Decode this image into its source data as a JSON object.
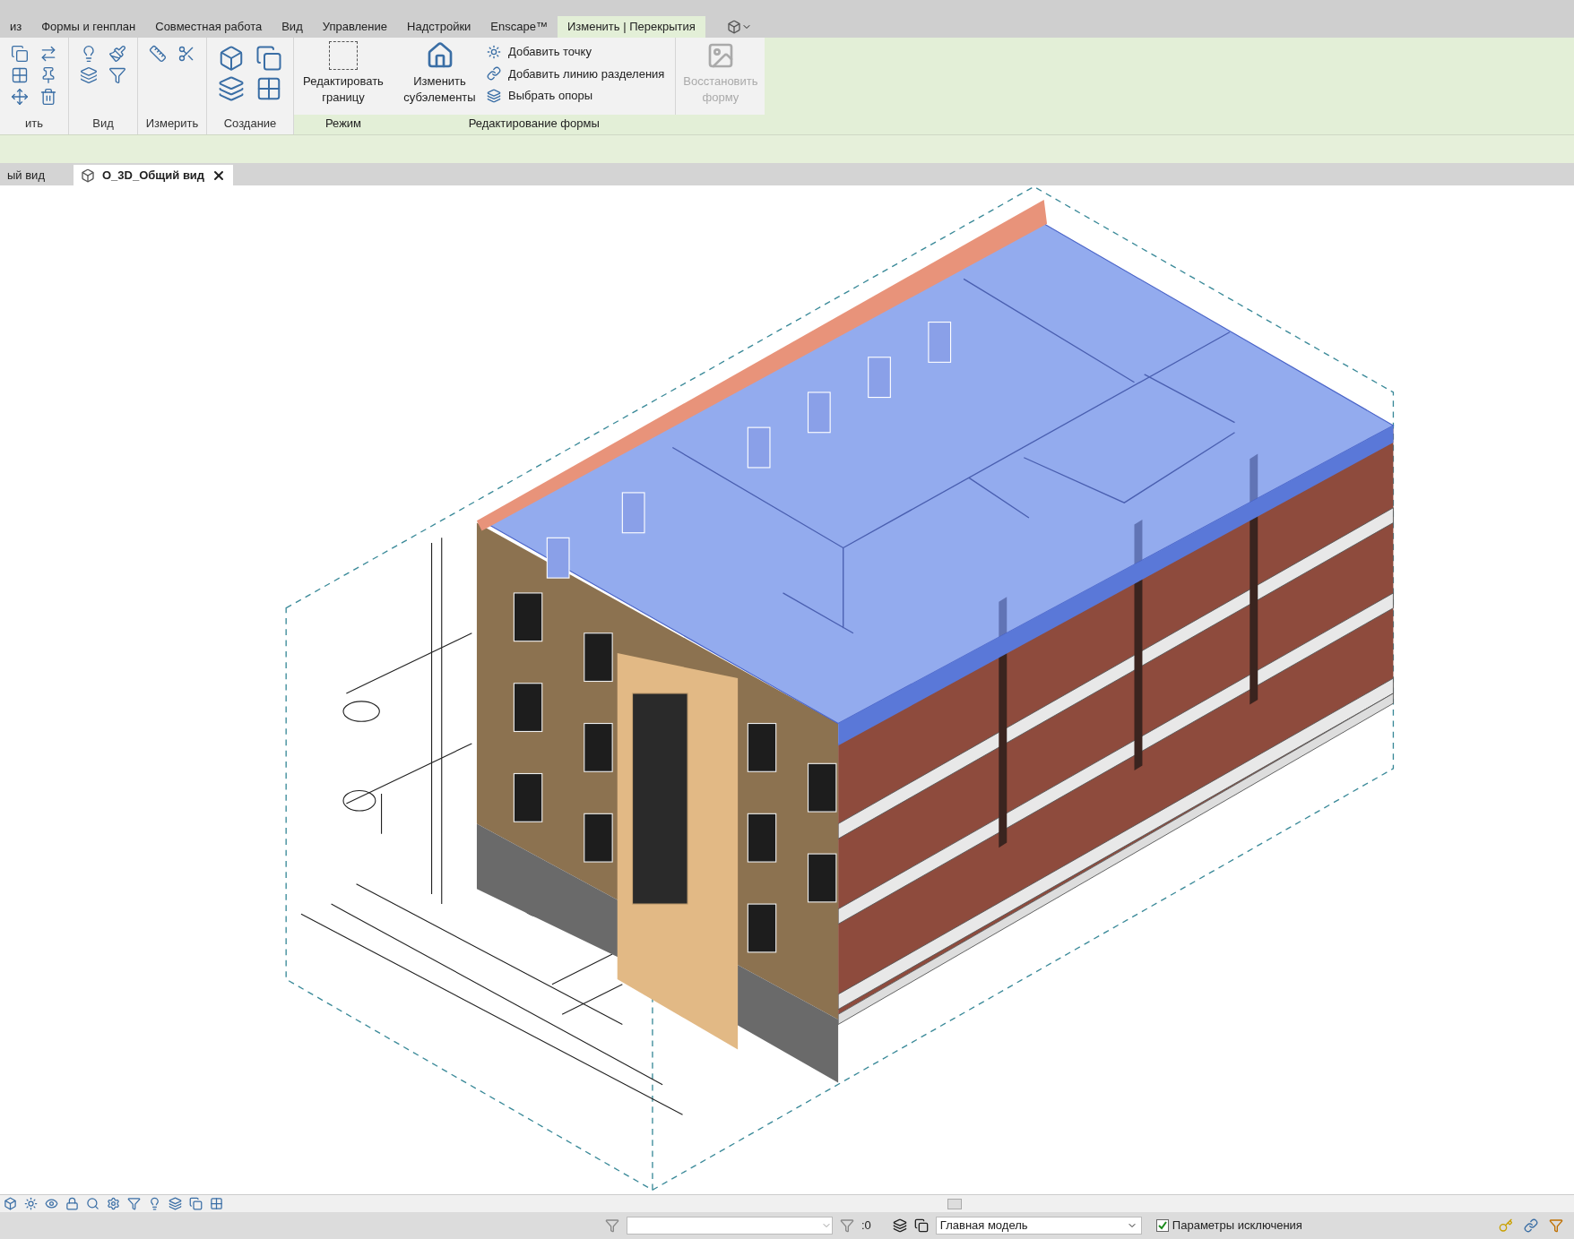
{
  "ribbon_tabs": [
    {
      "label": "из",
      "selected": false
    },
    {
      "label": "Формы и генплан",
      "selected": false
    },
    {
      "label": "Совместная работа",
      "selected": false
    },
    {
      "label": "Вид",
      "selected": false
    },
    {
      "label": "Управление",
      "selected": false
    },
    {
      "label": "Надстройки",
      "selected": false
    },
    {
      "label": "Enscape™",
      "selected": false
    },
    {
      "label": "Изменить | Перекрытия",
      "selected": true
    }
  ],
  "tool_panels": [
    "ить",
    "Вид",
    "Измерить",
    "Создание"
  ],
  "mode_panel": {
    "label": "Режим",
    "button": "Редактировать границу"
  },
  "shape_panel": {
    "label": "Редактирование формы",
    "big_button": "Изменить субэлементы",
    "commands": [
      "Добавить точку",
      "Добавить линию разделения",
      "Выбрать опоры"
    ],
    "restore_button": {
      "label": "Восстановить форму",
      "disabled": true
    }
  },
  "view_tabs": [
    {
      "label": "ый вид",
      "selected": false,
      "closable": false
    },
    {
      "label": "О_3D_Общий вид",
      "selected": true,
      "closable": true
    }
  ],
  "status_bar": {
    "selection_count": ":0",
    "workset": "Главная модель",
    "exclude_option": {
      "label": "Параметры исключения",
      "checked": true
    }
  }
}
